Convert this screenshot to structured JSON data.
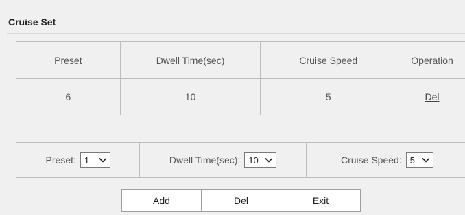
{
  "panel": {
    "title": "Cruise Set"
  },
  "table": {
    "headers": [
      "Preset",
      "Dwell Time(sec)",
      "Cruise Speed",
      "Operation"
    ],
    "rows": [
      {
        "preset": "6",
        "dwell_time": "10",
        "cruise_speed": "5",
        "operation": "Del"
      }
    ]
  },
  "controls": {
    "preset_label": "Preset:",
    "preset_value": "1",
    "dwell_label": "Dwell Time(sec):",
    "dwell_value": "10",
    "speed_label": "Cruise Speed:",
    "speed_value": "5"
  },
  "buttons": {
    "add": "Add",
    "del": "Del",
    "exit": "Exit"
  },
  "icons": {
    "select_arrow": "chevron-down-icon"
  }
}
